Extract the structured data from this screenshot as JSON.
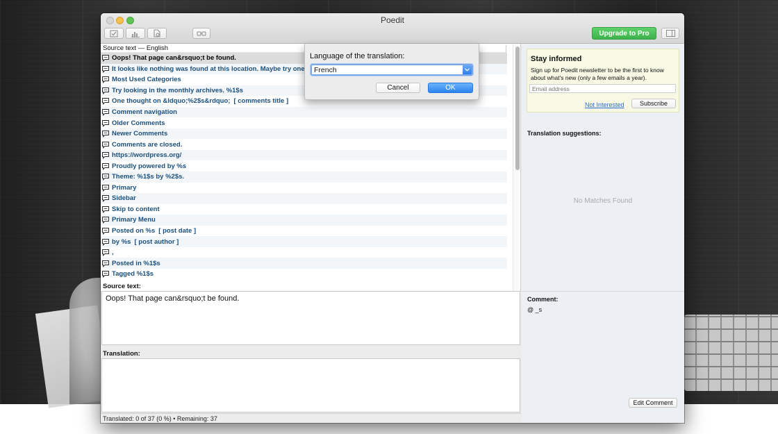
{
  "window": {
    "title": "Poedit"
  },
  "toolbar": {
    "upgrade_label": "Upgrade to Pro",
    "icons": [
      "validate-icon",
      "statistics-icon",
      "sources-icon",
      "preview-icon",
      "sidebar-toggle-icon"
    ]
  },
  "list": {
    "header": "Source text — English",
    "rows": [
      {
        "text": "Oops! That page can&rsquo;t be found.",
        "context": ""
      },
      {
        "text": "It looks like nothing was found at this location. Maybe try one ...",
        "context": ""
      },
      {
        "text": "Most Used Categories",
        "context": ""
      },
      {
        "text": "Try looking in the monthly archives. %1$s",
        "context": ""
      },
      {
        "text": "One thought on &ldquo;%2$s&rdquo;",
        "context": "[ comments title ]"
      },
      {
        "text": "Comment navigation",
        "context": ""
      },
      {
        "text": "Older Comments",
        "context": ""
      },
      {
        "text": "Newer Comments",
        "context": ""
      },
      {
        "text": "Comments are closed.",
        "context": ""
      },
      {
        "text": "https://wordpress.org/",
        "context": ""
      },
      {
        "text": "Proudly powered by %s",
        "context": ""
      },
      {
        "text": "Theme: %1$s by %2$s.",
        "context": ""
      },
      {
        "text": "Primary",
        "context": ""
      },
      {
        "text": "Sidebar",
        "context": ""
      },
      {
        "text": "Skip to content",
        "context": ""
      },
      {
        "text": "Primary Menu",
        "context": ""
      },
      {
        "text": "Posted on %s",
        "context": "[ post date ]"
      },
      {
        "text": "by %s",
        "context": "[ post author ]"
      },
      {
        "text": ",",
        "context": ""
      },
      {
        "text": "Posted in %1$s",
        "context": ""
      },
      {
        "text": "Tagged %1$s",
        "context": ""
      }
    ]
  },
  "editor": {
    "source_label": "Source text:",
    "source_value": "Oops! That page can&rsquo;t be found.",
    "translation_label": "Translation:",
    "translation_value": ""
  },
  "status": {
    "text": "Translated: 0 of 37 (0 %)  •  Remaining: 37"
  },
  "sidebar": {
    "newsletter_title": "Stay informed",
    "newsletter_text": "Sign up for Poedit newsletter to be the first to know about what's new (only a few emails a year).",
    "email_placeholder": "Email address",
    "not_interested": "Not Interested",
    "subscribe": "Subscribe",
    "suggestions_label": "Translation suggestions:",
    "no_matches": "No Matches Found",
    "comment_label": "Comment:",
    "comment_text": "@ _s",
    "edit_comment": "Edit Comment"
  },
  "dialog": {
    "label": "Language of the translation:",
    "language_value": "French",
    "cancel": "Cancel",
    "ok": "OK"
  },
  "colors": {
    "accent": "#2b84f0",
    "upgrade_green": "#3cb24a",
    "row_text": "#1a4f7d"
  }
}
